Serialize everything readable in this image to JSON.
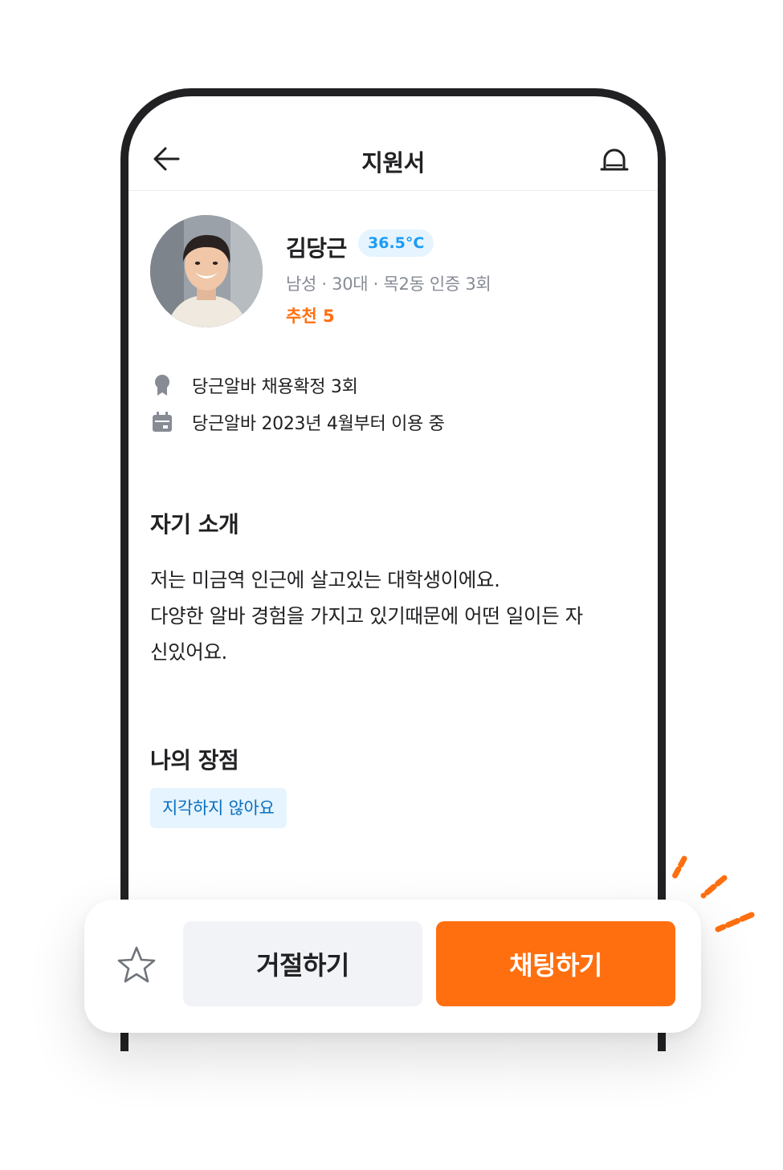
{
  "header": {
    "title": "지원서",
    "back_icon": "arrow-left-icon",
    "siren_icon": "siren-icon"
  },
  "profile": {
    "name": "김당근",
    "temperature": "36.5°C",
    "meta": "남성 · 30대 · 목2동 인증 3회",
    "recommend": "추천 5"
  },
  "stats": [
    {
      "icon": "medal-icon",
      "text": "당근알바 채용확정 3회"
    },
    {
      "icon": "calendar-icon",
      "text": "당근알바 2023년 4월부터 이용 중"
    }
  ],
  "intro": {
    "title": "자기 소개",
    "lines": [
      "저는 미금역 인근에 살고있는 대학생이에요.",
      "다양한 알바 경험을 가지고 있기때문에 어떤 일이든 자",
      "신있어요."
    ]
  },
  "strengths": {
    "title": "나의 장점",
    "tags": [
      "지각하지 않아요"
    ]
  },
  "actions": {
    "star_icon": "star-icon",
    "reject_label": "거절하기",
    "chat_label": "채팅하기"
  },
  "colors": {
    "brand_orange": "#ff6f0f",
    "temp_blue": "#1c9cf6",
    "tag_bg": "#e5f4fe"
  }
}
